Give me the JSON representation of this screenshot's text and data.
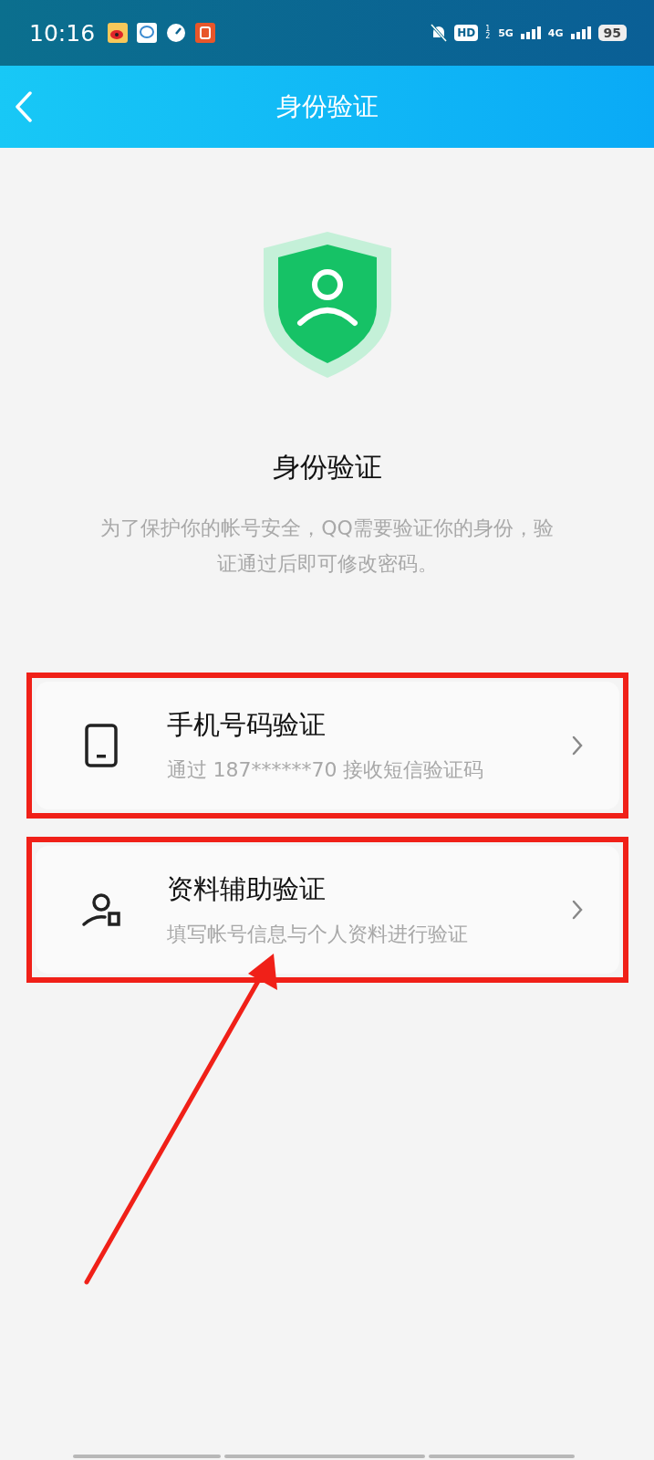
{
  "status_bar": {
    "time": "10:16",
    "hd": "HD",
    "sim_marks": "12",
    "network_1": "5G",
    "network_2": "4G",
    "battery": "95"
  },
  "header": {
    "title": "身份验证"
  },
  "intro": {
    "title": "身份验证",
    "description": "为了保护你的帐号安全，QQ需要验证你的身份，验证通过后即可修改密码。"
  },
  "options": [
    {
      "kind": "phone",
      "title": "手机号码验证",
      "subtitle": "通过 187******70 接收短信验证码",
      "highlighted": true
    },
    {
      "kind": "profile",
      "title": "资料辅助验证",
      "subtitle": "填写帐号信息与个人资料进行验证",
      "highlighted": true
    }
  ],
  "annotations": [
    {
      "kind": "arrow"
    }
  ]
}
